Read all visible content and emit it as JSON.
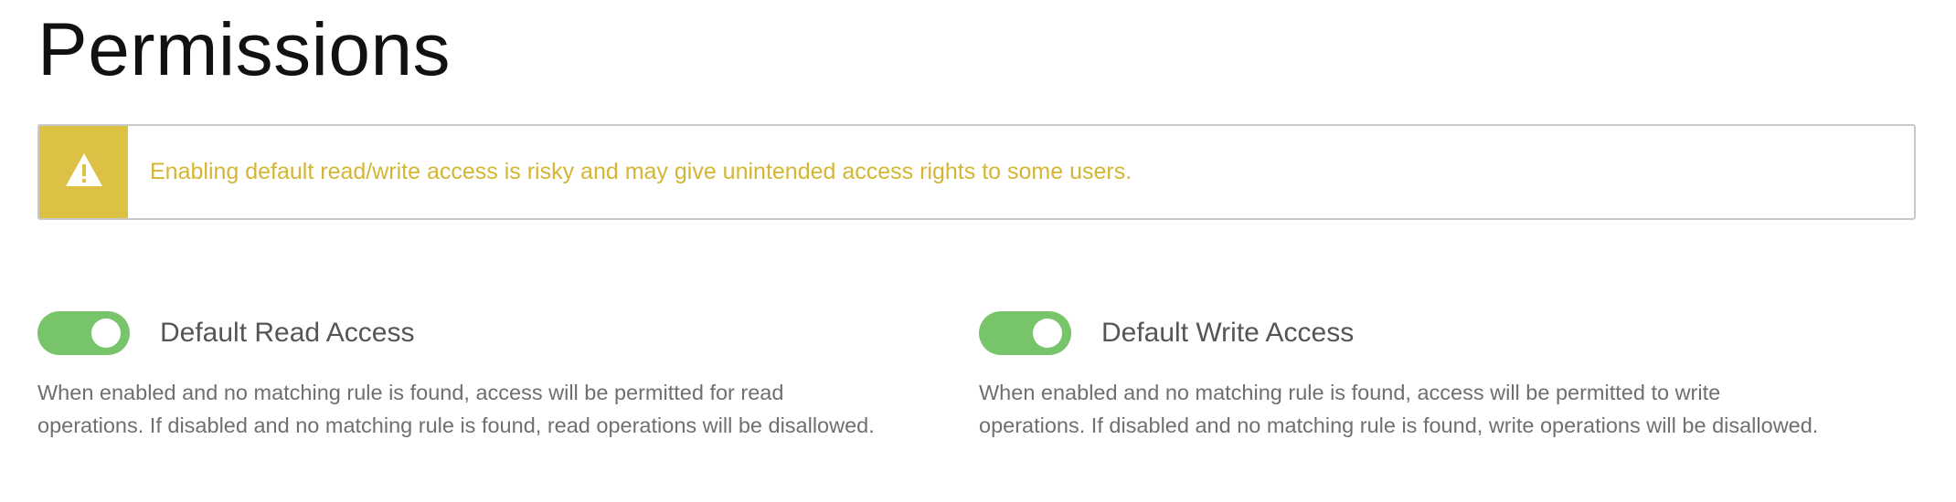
{
  "page": {
    "title": "Permissions"
  },
  "alert": {
    "icon": "warning-triangle-icon",
    "message": "Enabling default read/write access is risky and may give unintended access rights to some users.",
    "colors": {
      "icon_background": "#dcc144",
      "text": "#d5b534",
      "border": "#c9c9c9"
    }
  },
  "settings": [
    {
      "label": "Default Read Access",
      "enabled": true,
      "description_line1": "When enabled and no matching rule is found, access will be permitted for read",
      "description_line2": "operations. If disabled and no matching rule is found, read operations will be disallowed."
    },
    {
      "label": "Default Write Access",
      "enabled": true,
      "description_line1": "When enabled and no matching rule is found, access will be permitted to write",
      "description_line2": "operations. If disabled and no matching rule is found, write operations will be disallowed."
    }
  ],
  "colors": {
    "toggle_on": "#77c46a",
    "title": "#111111",
    "label": "#555555",
    "description": "#6f6f6f"
  }
}
